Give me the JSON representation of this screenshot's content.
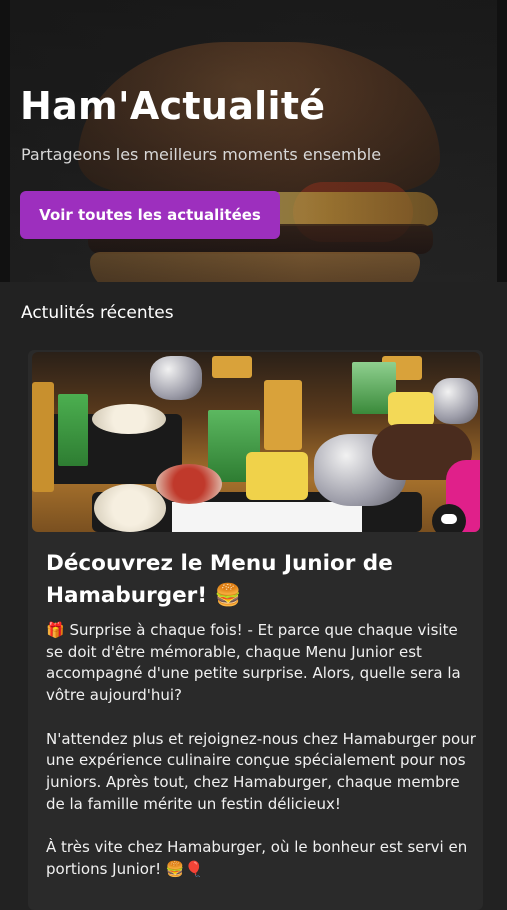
{
  "hero": {
    "title": "Ham'Actualité",
    "subtitle": "Partageons les meilleurs moments ensemble",
    "button_label": "Voir toutes les actualitées",
    "button_color": "#9d2fbe"
  },
  "section": {
    "title": "Actulités récentes"
  },
  "card": {
    "title": "Découvrez le Menu Junior de Hamaburger! 🍔",
    "paragraphs": [
      "🎁 Surprise à chaque fois! - Et parce que chaque visite se doit d'être mémorable, chaque Menu Junior est accompagné d'une petite surprise. Alors, quelle sera la vôtre aujourd'hui?",
      "N'attendez plus et rejoignez-nous chez Hamaburger pour une expérience culinaire conçue spécialement pour nos juniors. Après tout, chez Hamaburger, chaque membre de la famille mérite un festin délicieux!",
      "À très vite chez Hamaburger, où le bonheur est servi en portions Junior! 🍔🎈"
    ]
  },
  "colors": {
    "background": "#222222",
    "card": "#2a2a2a",
    "accent": "#9d2fbe"
  },
  "icons": {
    "chat": "chat-bubble-icon"
  }
}
